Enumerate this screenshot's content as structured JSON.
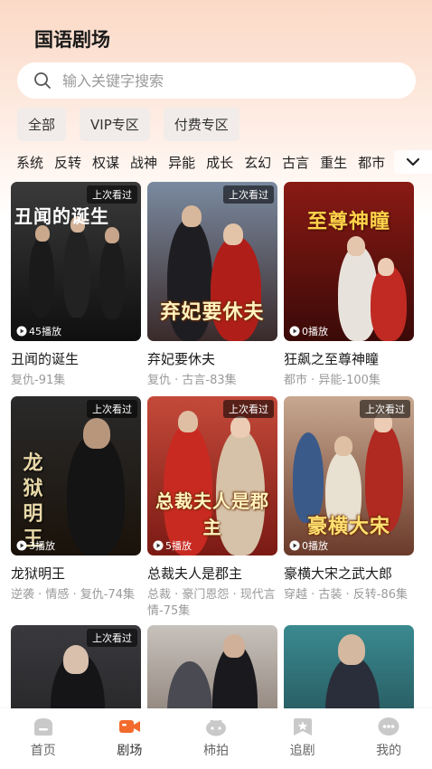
{
  "header": {
    "title": "国语剧场"
  },
  "search": {
    "placeholder": "输入关键字搜索"
  },
  "filters": [
    "全部",
    "VIP专区",
    "付费专区"
  ],
  "genres": [
    "系统",
    "反转",
    "权谋",
    "战神",
    "异能",
    "成长",
    "玄幻",
    "古言",
    "重生",
    "都市"
  ],
  "dramas": [
    {
      "title": "丑闻的诞生",
      "tags": "复仇-91集",
      "plays": "45播放",
      "badge": "上次看过",
      "poster_text": "丑闻的诞生",
      "bg": [
        "#3a3a3a",
        "#0f0f10"
      ]
    },
    {
      "title": "弃妃要休夫",
      "tags": "复仇 · 古言-83集",
      "plays": "",
      "badge": "上次看过",
      "poster_text": "弃妃要休夫",
      "bg": [
        "#7a8aa0",
        "#3a2a2a"
      ]
    },
    {
      "title": "狂飙之至尊神瞳",
      "tags": "都市 · 异能-100集",
      "plays": "0播放",
      "badge": "",
      "poster_text": "至尊神瞳",
      "bg": [
        "#8a1a14",
        "#3a0a08"
      ]
    },
    {
      "title": "龙狱明王",
      "tags": "逆袭 · 情感 · 复仇-74集",
      "plays": "3播放",
      "badge": "上次看过",
      "poster_text": "龙狱明王",
      "bg": [
        "#2a2a2a",
        "#1a120a"
      ]
    },
    {
      "title": "总裁夫人是郡主",
      "tags": "总裁 · 豪门恩怨 · 现代言情-75集",
      "plays": "5播放",
      "badge": "上次看过",
      "poster_text": "总裁夫人是郡主",
      "bg": [
        "#c44a3a",
        "#7a1a14"
      ]
    },
    {
      "title": "豪横大宋之武大郎",
      "tags": "穿越 · 古装 · 反转-86集",
      "plays": "0播放",
      "badge": "上次看过",
      "poster_text": "豪横大宋",
      "bg": [
        "#c8a890",
        "#6a3a2a"
      ]
    },
    {
      "title": "",
      "tags": "",
      "plays": "",
      "badge": "上次看过",
      "poster_text": "",
      "bg": [
        "#3a3a3e",
        "#1a1a1c"
      ]
    },
    {
      "title": "",
      "tags": "",
      "plays": "",
      "badge": "",
      "poster_text": "",
      "bg": [
        "#c8c2bc",
        "#6a5a50"
      ]
    },
    {
      "title": "",
      "tags": "",
      "plays": "",
      "badge": "",
      "poster_text": "",
      "bg": [
        "#3a8a90",
        "#1a3a40"
      ]
    }
  ],
  "tabbar": [
    {
      "label": "首页",
      "icon": "home-icon"
    },
    {
      "label": "剧场",
      "icon": "video-camera-icon",
      "active": true
    },
    {
      "label": "柿拍",
      "icon": "persimmon-icon"
    },
    {
      "label": "追剧",
      "icon": "bookmark-icon"
    },
    {
      "label": "我的",
      "icon": "chat-bubble-icon"
    }
  ],
  "colors": {
    "accent": "#f26a2c",
    "tab_inactive": "#c9c9c9"
  }
}
